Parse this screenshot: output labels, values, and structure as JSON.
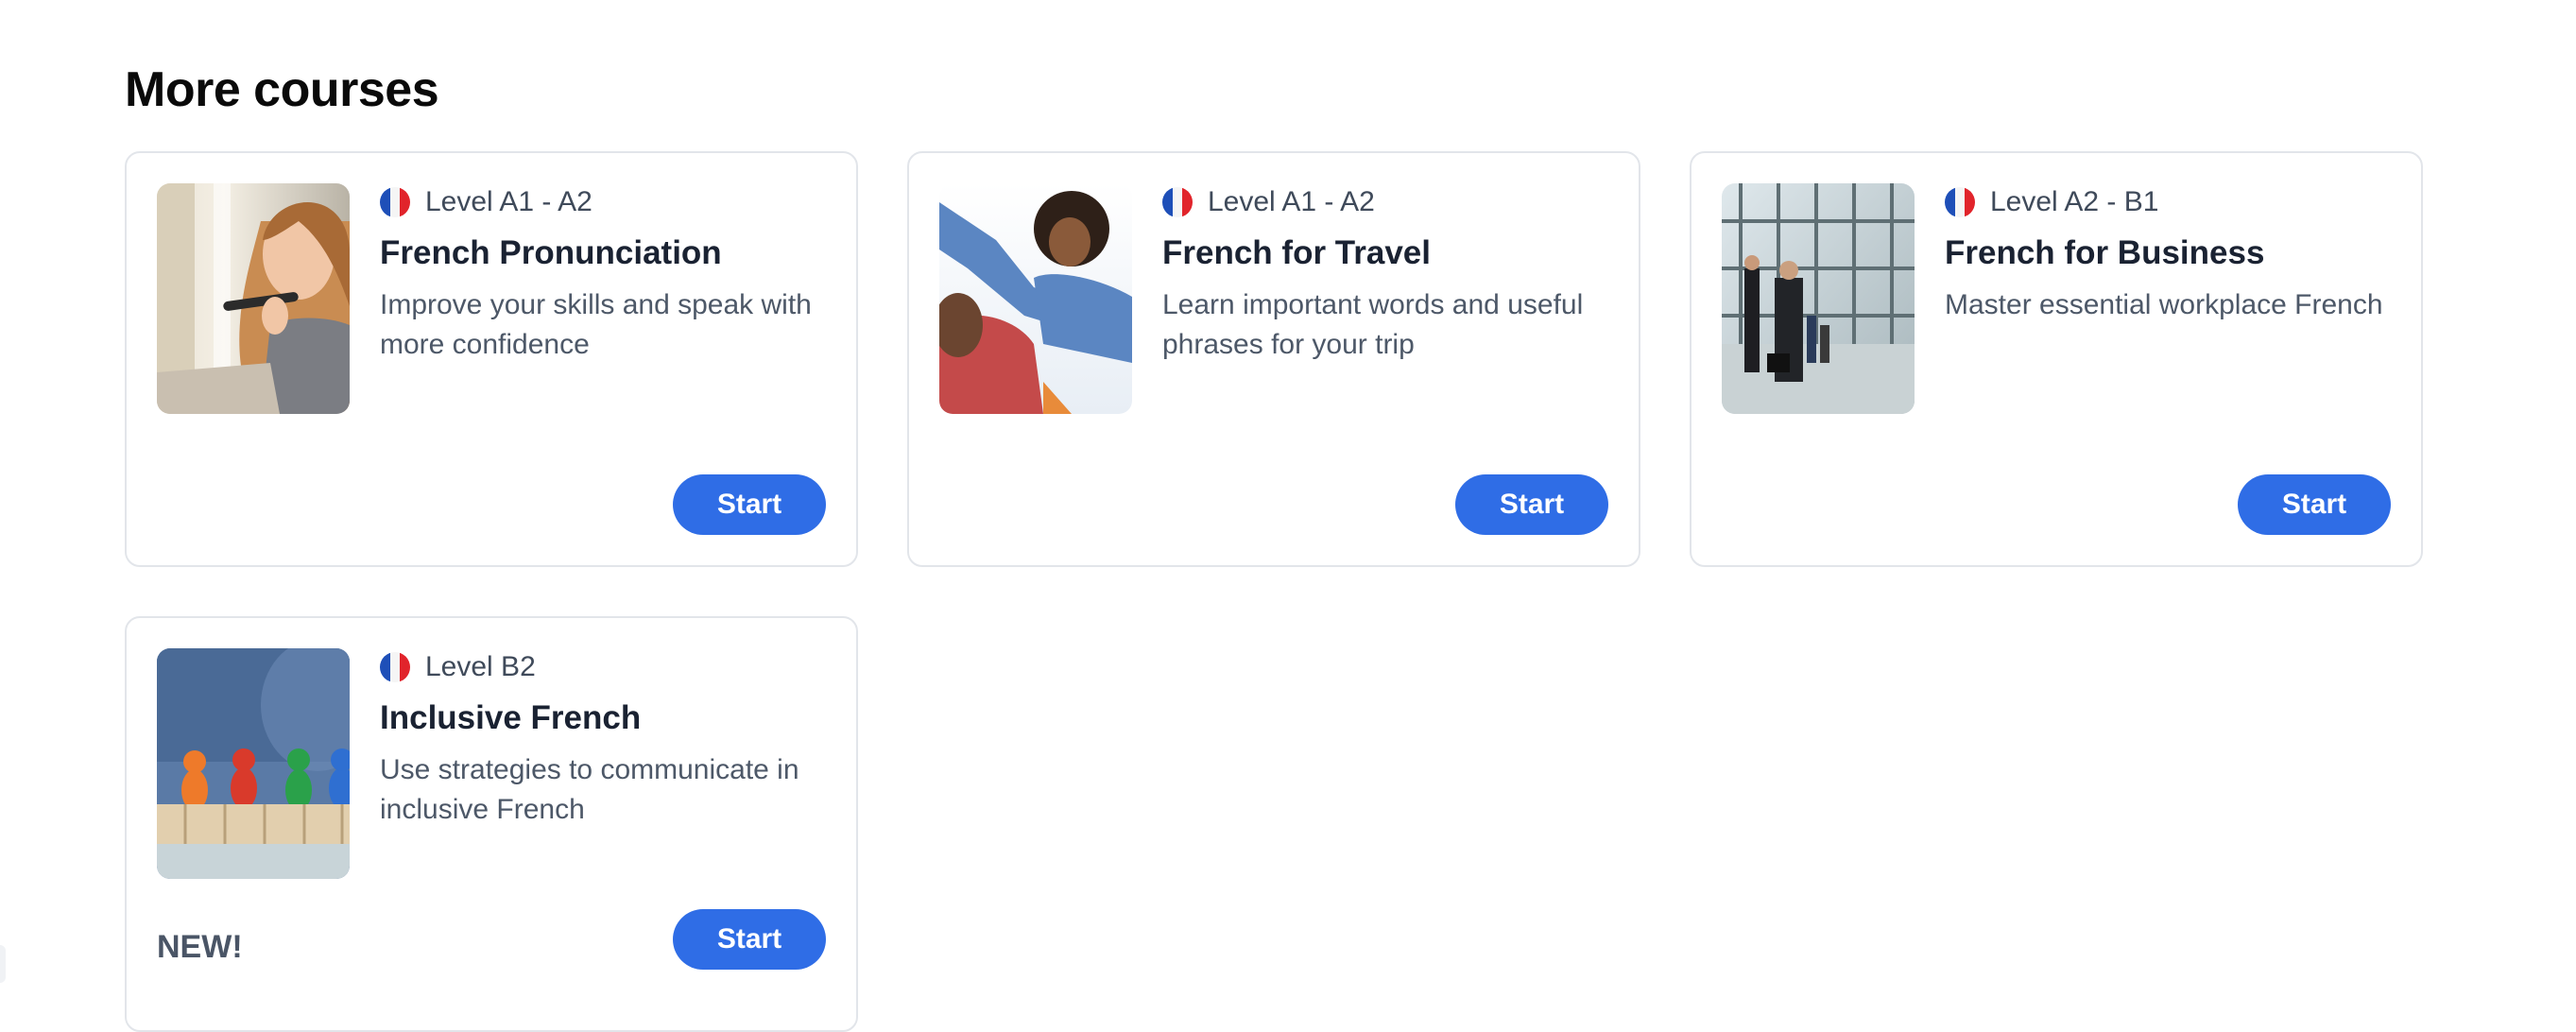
{
  "section": {
    "title": "More courses"
  },
  "courses": [
    {
      "level": "Level A1 - A2",
      "title": "French Pronunciation",
      "description": "Improve your skills and speak with more confidence",
      "start_label": "Start",
      "flag_icon": "france-flag-icon",
      "image": "woman-speaking-into-phone-image"
    },
    {
      "level": "Level A1 - A2",
      "title": "French for Travel",
      "description": "Learn important words and useful phrases for your trip",
      "start_label": "Start",
      "flag_icon": "france-flag-icon",
      "image": "happy-travelers-image"
    },
    {
      "level": "Level A2 - B1",
      "title": "French for Business",
      "description": "Master essential workplace French",
      "start_label": "Start",
      "flag_icon": "france-flag-icon",
      "image": "business-people-in-lobby-image"
    },
    {
      "level": "Level B2",
      "title": "Inclusive French",
      "description": "Use strategies to communicate in inclusive French",
      "start_label": "Start",
      "badge": "NEW!",
      "flag_icon": "france-flag-icon",
      "image": "inclusion-blocks-image"
    }
  ],
  "colors": {
    "accent": "#2f6de6",
    "card_border": "#e2e5ea",
    "title_text": "#1a2232",
    "body_text": "#4d5868"
  }
}
